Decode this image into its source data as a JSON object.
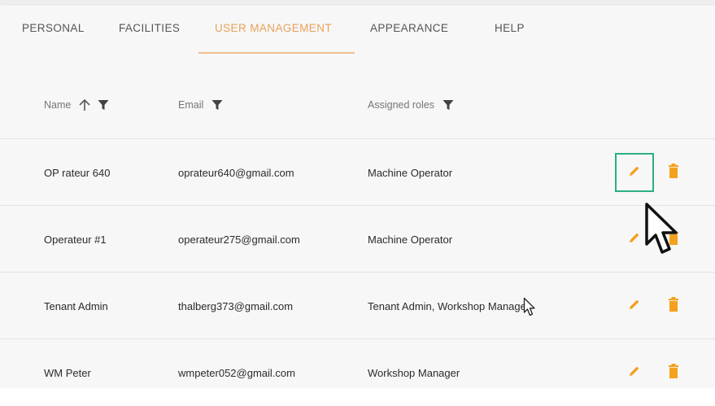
{
  "tabs": [
    {
      "label": "PERSONAL"
    },
    {
      "label": "FACILITIES"
    },
    {
      "label": "USER MANAGEMENT"
    },
    {
      "label": "APPEARANCE"
    },
    {
      "label": "HELP"
    }
  ],
  "active_tab": "USER MANAGEMENT",
  "table": {
    "columns": {
      "name": "Name",
      "email": "Email",
      "roles": "Assigned roles"
    },
    "sort": {
      "column": "Name",
      "direction": "ascending"
    },
    "rows": [
      {
        "name": "OP rateur 640",
        "email": "oprateur640@gmail.com",
        "roles": "Machine Operator"
      },
      {
        "name": "Operateur #1",
        "email": "operateur275@gmail.com",
        "roles": "Machine Operator"
      },
      {
        "name": "Tenant Admin",
        "email": "thalberg373@gmail.com",
        "roles": "Tenant Admin, Workshop Manager"
      },
      {
        "name": "WM Peter",
        "email": "wmpeter052@gmail.com",
        "roles": "Workshop Manager"
      }
    ]
  },
  "icons": {
    "sort": "arrow-up-icon",
    "filter": "filter-icon",
    "edit": "pencil-icon",
    "delete": "trash-icon",
    "cursor": "mouse-pointer-icon"
  },
  "colors": {
    "accent": "#e8a25a",
    "action_icon": "#f4a11e",
    "focus_outline": "#2bae86"
  }
}
